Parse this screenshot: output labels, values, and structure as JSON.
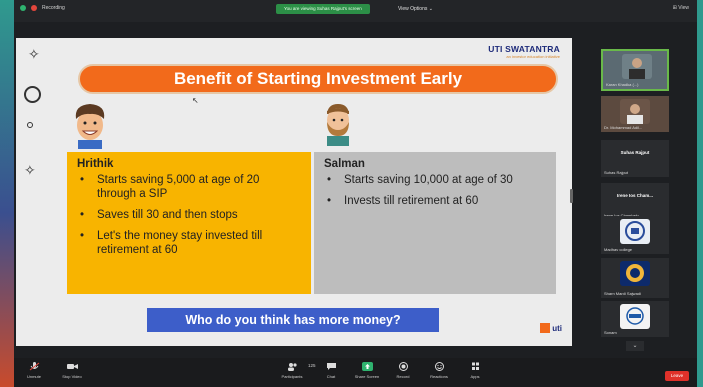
{
  "topbar": {
    "recording_label": "Recording",
    "viewing_banner": "You are viewing Suhas Rajput's screen",
    "view_options": "View Options ⌄",
    "view_button": "⊞ View"
  },
  "slide": {
    "brand_name": "UTI SWATANTRA",
    "brand_tagline": "an investor education initiative",
    "title": "Benefit of Starting Investment Early",
    "hrithik": {
      "name": "Hrithik",
      "points": [
        "Starts saving 5,000 at age of 20 through a SIP",
        "Saves till 30 and then stops",
        "Let's the money stay invested till retirement at 60"
      ]
    },
    "salman": {
      "name": "Salman",
      "points": [
        "Starts saving 10,000 at age of 30",
        "Invests till retirement at 60"
      ]
    },
    "question": "Who do you think has more money?",
    "logo_text": "uti"
  },
  "participants": [
    {
      "name": "Karan Khadka (...)"
    },
    {
      "name": "Dr. Mohammad Adil..."
    },
    {
      "name": "Suhas Rajput",
      "center": "Suhas Rajput"
    },
    {
      "name": "Irene Ios Chamhely",
      "center": "Irene Ios Cham..."
    },
    {
      "name": "Madhav college"
    },
    {
      "name": "Sharn Mardi Sajwadi"
    },
    {
      "name": "Sonam"
    }
  ],
  "toolbar": {
    "unmute": "Unmute",
    "stop_video": "Stop Video",
    "participants": "Participants",
    "participants_count": "125",
    "chat": "Chat",
    "share_screen": "Share Screen",
    "record": "Record",
    "reactions": "Reactions",
    "apps": "Apps",
    "leave": "Leave"
  },
  "colors": {
    "title_orange": "#f26a1b",
    "hrithik_yellow": "#f8b400",
    "salman_gray": "#bdbdbd",
    "question_blue": "#3d5ec9",
    "share_green": "#2fb36f",
    "leave_red": "#e0312a"
  }
}
